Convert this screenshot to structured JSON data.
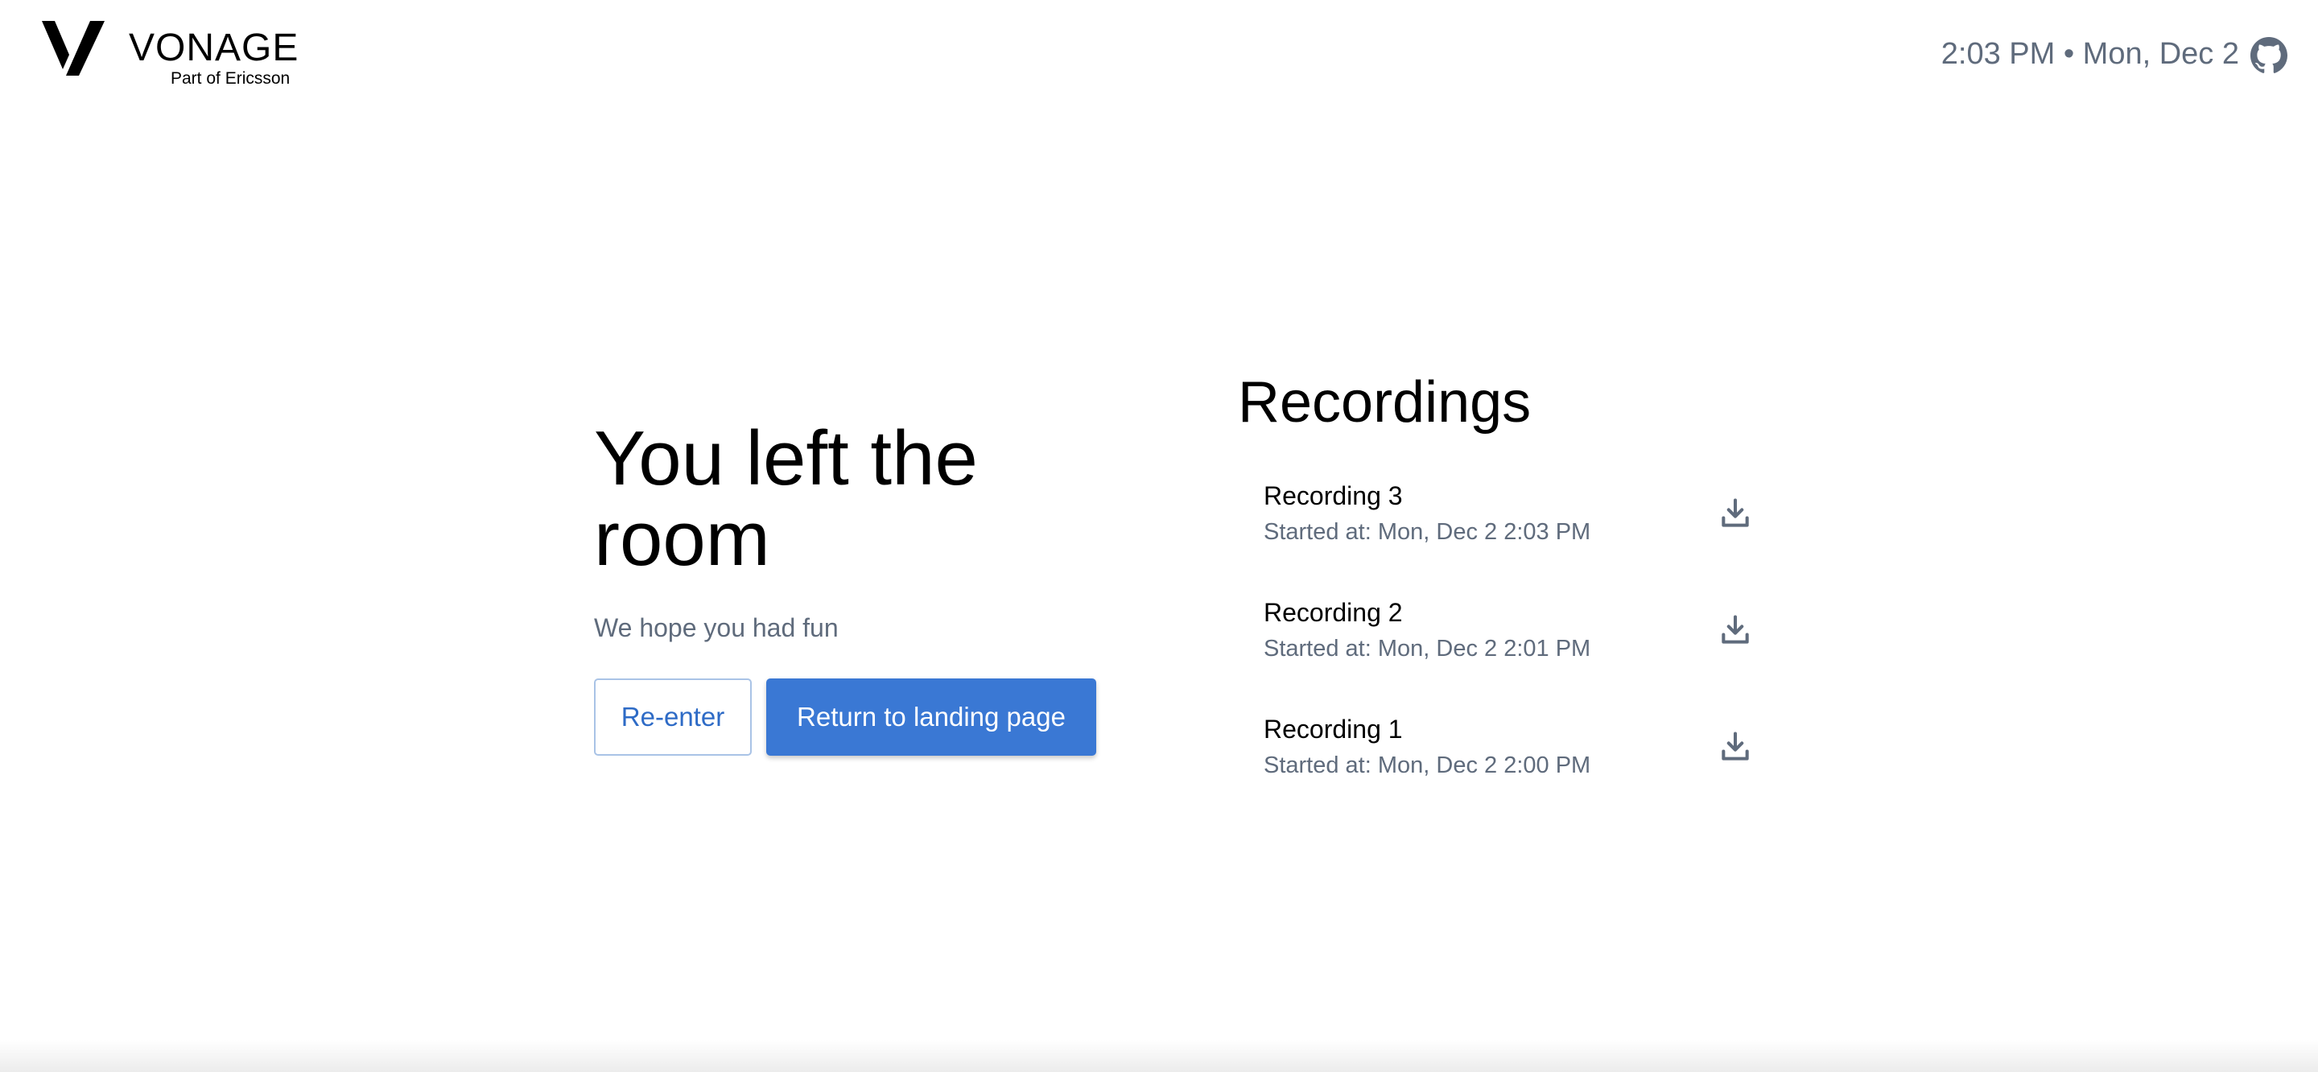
{
  "header": {
    "logo_word": "VONAGE",
    "logo_sub": "Part of Ericsson",
    "clock": "2:03 PM • Mon, Dec 2",
    "github_icon": "github-icon"
  },
  "main": {
    "title": "You left the room",
    "subtitle": "We hope you had fun",
    "reenter_label": "Re-enter",
    "return_label": "Return to landing page"
  },
  "recordings": {
    "title": "Recordings",
    "items": [
      {
        "name": "Recording 3",
        "started": "Started at: Mon, Dec 2 2:03 PM",
        "icon": "download-icon"
      },
      {
        "name": "Recording 2",
        "started": "Started at: Mon, Dec 2 2:01 PM",
        "icon": "download-icon"
      },
      {
        "name": "Recording 1",
        "started": "Started at: Mon, Dec 2 2:00 PM",
        "icon": "download-icon"
      }
    ]
  },
  "colors": {
    "primary": "#3a78d4",
    "muted_text": "#5f6b7c",
    "outline_border": "#a9c3e6"
  }
}
